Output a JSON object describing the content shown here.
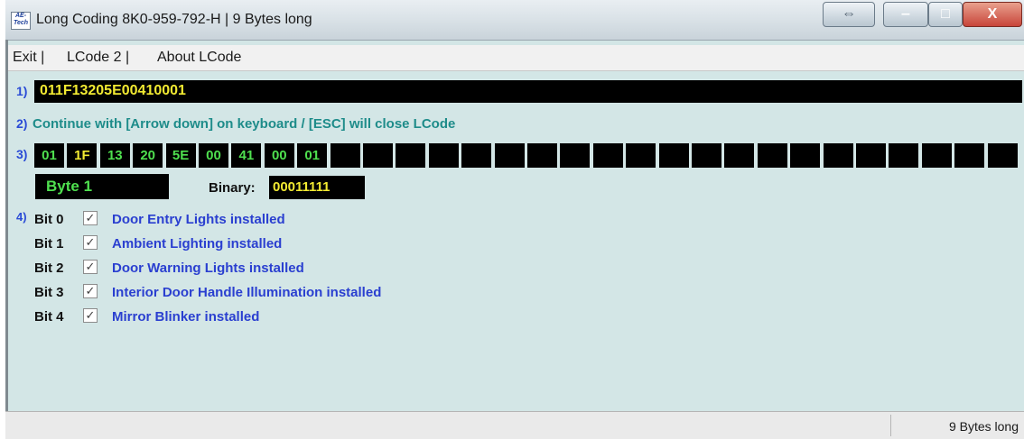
{
  "window": {
    "title": "Long Coding  8K0-959-792-H | 9 Bytes long",
    "icon_text": "AE-Tech",
    "controls": {
      "resize": "⇔",
      "minimize": "‒",
      "maximize": "□",
      "close": "X"
    }
  },
  "menu": {
    "items": [
      "Exit |",
      "LCode 2 |",
      "About LCode"
    ]
  },
  "row1": {
    "label": "1)",
    "code": "011F13205E00410001"
  },
  "row2": {
    "label": "2)",
    "text": "Continue with [Arrow down] on keyboard / [ESC] will close LCode"
  },
  "row3": {
    "label": "3)",
    "bytes": [
      "01",
      "1F",
      "13",
      "20",
      "5E",
      "00",
      "41",
      "00",
      "01",
      "",
      "",
      "",
      "",
      "",
      "",
      "",
      "",
      "",
      "",
      "",
      "",
      "",
      "",
      "",
      "",
      "",
      "",
      "",
      "",
      ""
    ],
    "selected_index": 1
  },
  "byte_info": {
    "label": "Byte 1",
    "binary_label": "Binary:",
    "binary_value": "00011111"
  },
  "row4": {
    "label": "4)",
    "bits": [
      {
        "name": "Bit 0",
        "checked": true,
        "desc": "Door Entry Lights installed"
      },
      {
        "name": "Bit 1",
        "checked": true,
        "desc": "Ambient Lighting installed"
      },
      {
        "name": "Bit 2",
        "checked": true,
        "desc": "Door Warning Lights installed"
      },
      {
        "name": "Bit 3",
        "checked": true,
        "desc": "Interior Door Handle Illumination installed"
      },
      {
        "name": "Bit 4",
        "checked": true,
        "desc": "Mirror Blinker installed"
      }
    ],
    "check_glyph": "✓"
  },
  "status": {
    "text": "9 Bytes long"
  },
  "colors": {
    "background": "#d3e6e6",
    "code_text": "#f2ea32",
    "byte_text": "#4fe04f",
    "hint_text": "#1e8c8a",
    "bit_desc": "#2a3fd0"
  }
}
